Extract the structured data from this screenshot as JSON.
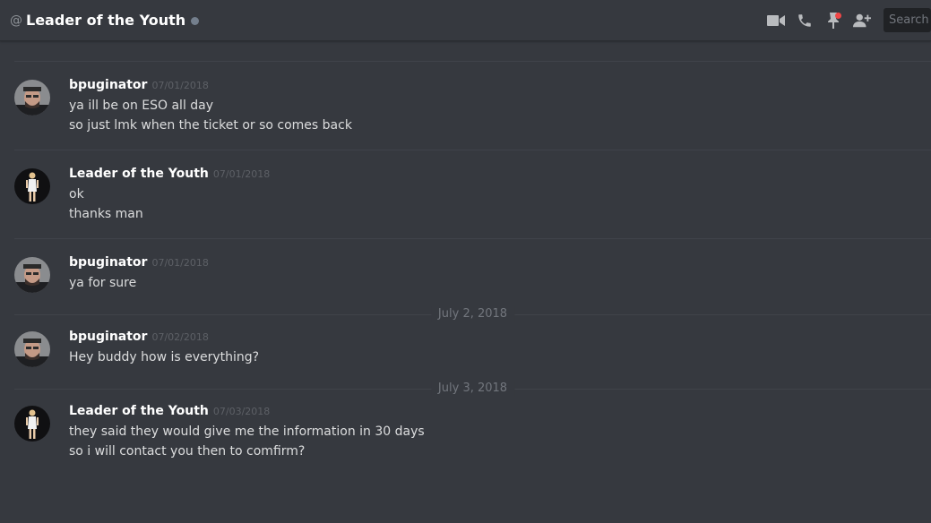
{
  "header": {
    "at_symbol": "@",
    "title": "Leader of the Youth",
    "search_placeholder": "Search",
    "icons": [
      "video-call-icon",
      "phone-call-icon",
      "pin-icon",
      "add-friend-icon"
    ]
  },
  "colors": {
    "background": "#36393f",
    "search_bg": "#202225",
    "status_offline": "#747f8d",
    "badge_red": "#f04747"
  },
  "messages": [
    {
      "author": "bpuginator",
      "timestamp": "07/01/2018",
      "lines": [
        "ya ill be on ESO all day",
        "so just lmk when the ticket or so comes back"
      ]
    },
    {
      "author": "Leader of the Youth",
      "timestamp": "07/01/2018",
      "lines": [
        "ok",
        "thanks man"
      ]
    },
    {
      "author": "bpuginator",
      "timestamp": "07/01/2018",
      "lines": [
        "ya for sure"
      ]
    },
    {
      "date_divider": "July 2, 2018"
    },
    {
      "author": "bpuginator",
      "timestamp": "07/02/2018",
      "lines": [
        "Hey buddy how is everything?"
      ]
    },
    {
      "date_divider": "July 3, 2018"
    },
    {
      "author": "Leader of the Youth",
      "timestamp": "07/03/2018",
      "lines": [
        "they said they would give me the information in 30 days",
        "so i will contact you then to comfirm?"
      ]
    }
  ]
}
